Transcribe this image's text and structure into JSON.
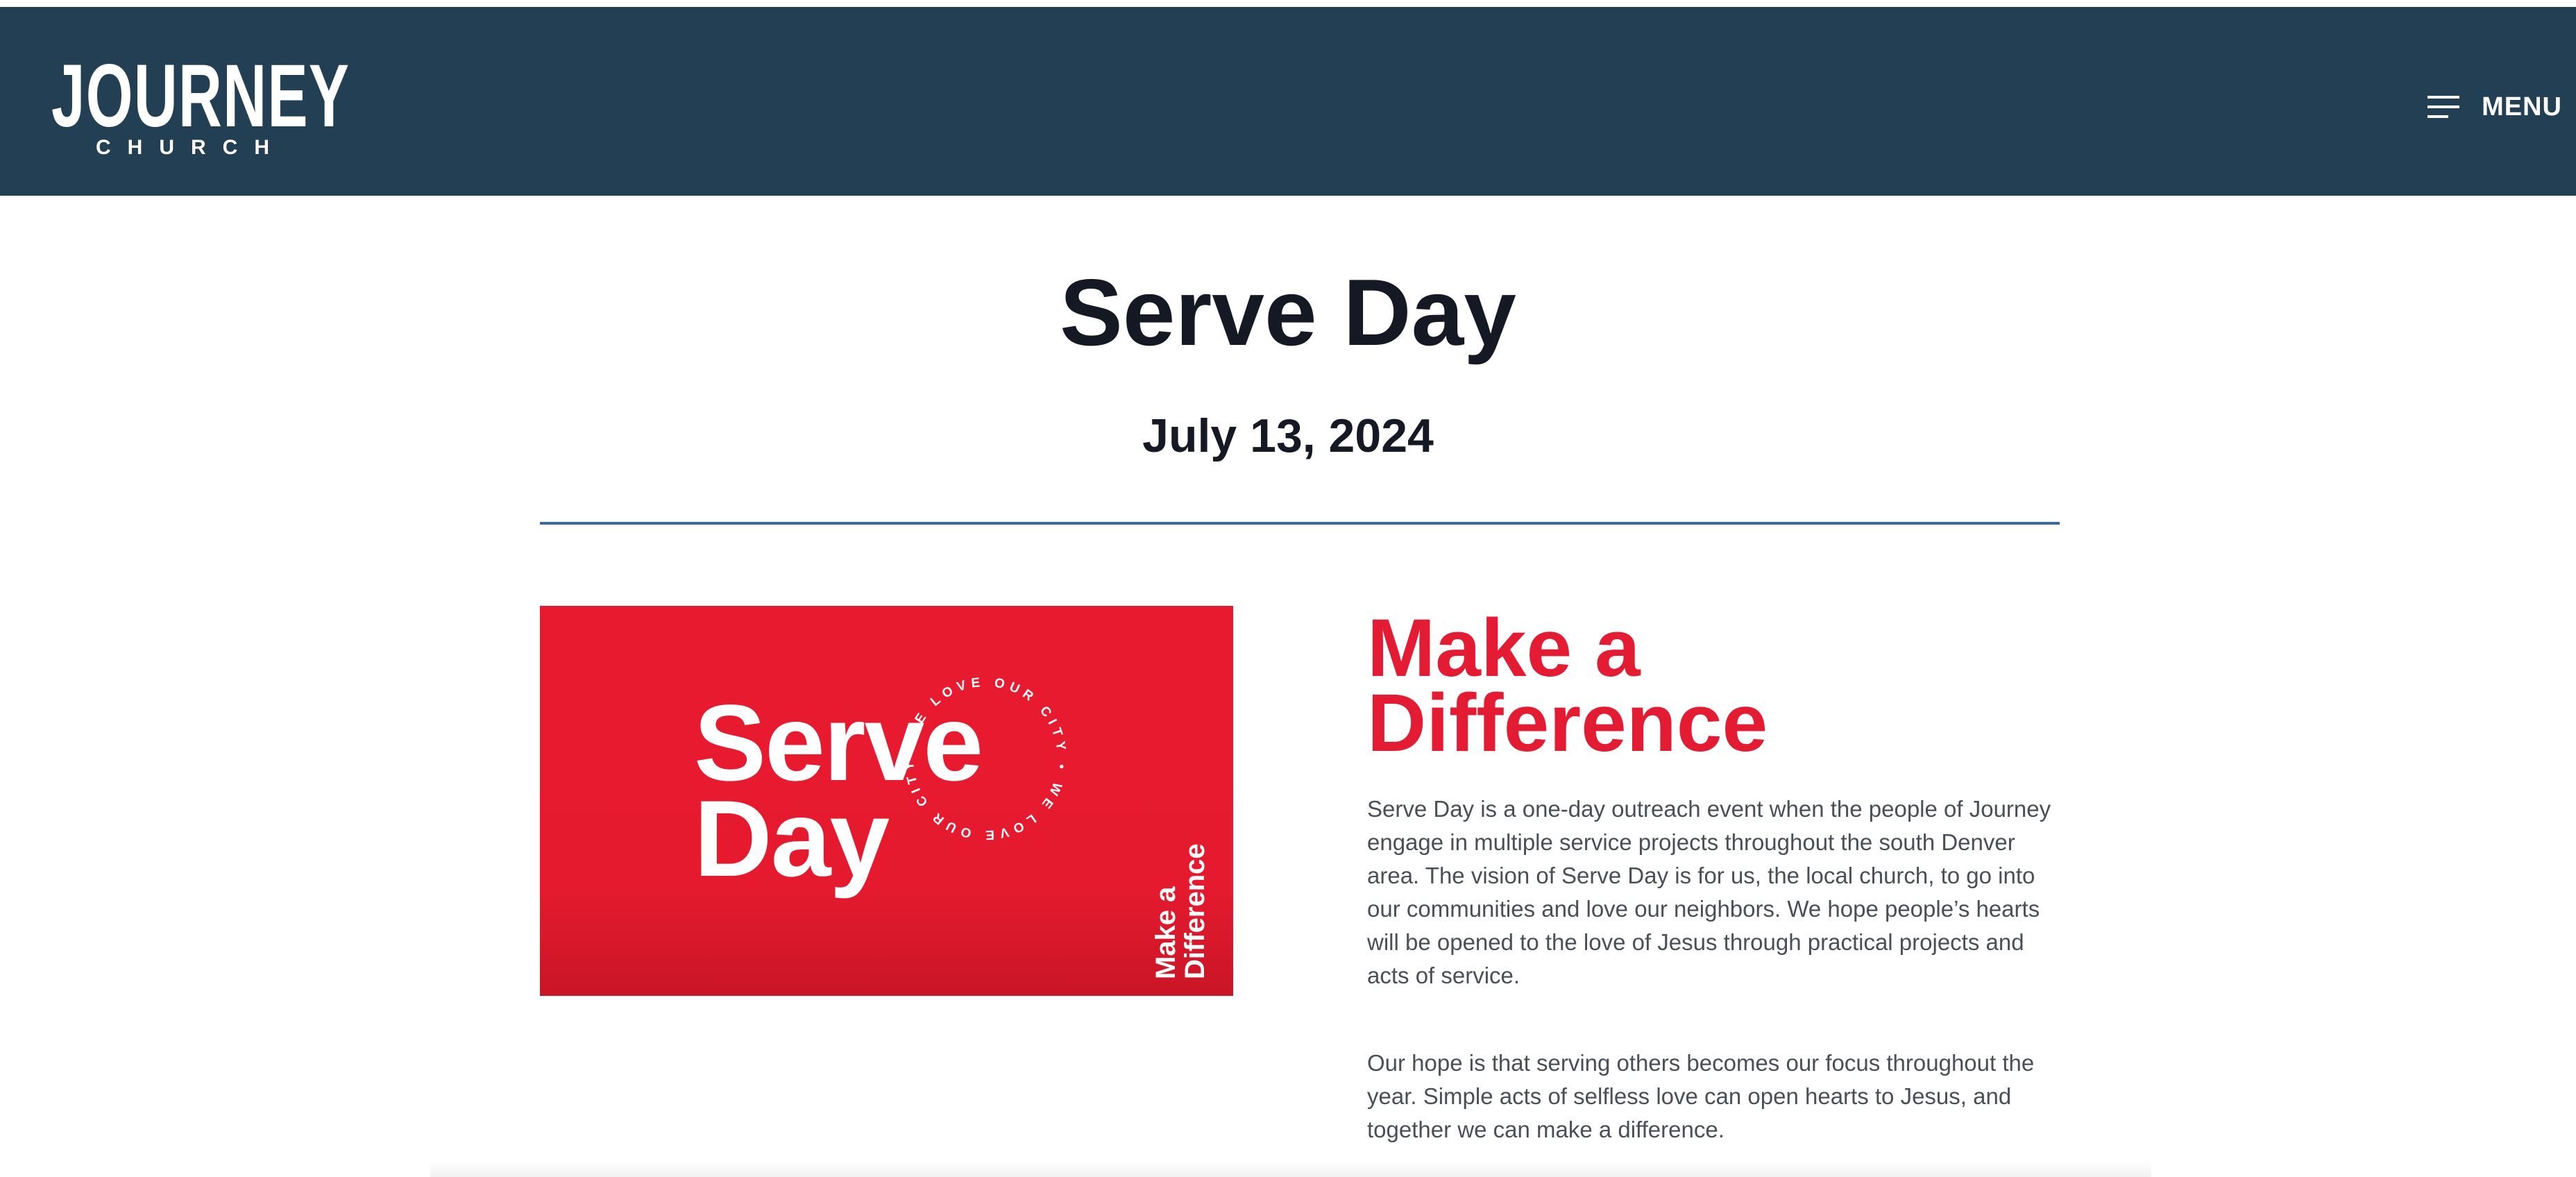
{
  "header": {
    "logo": {
      "wordmark": "JOURNEY",
      "subtitle": "CHURCH",
      "icon": "journey-j-icon"
    },
    "menu": {
      "label": "MENU",
      "icon": "hamburger-icon"
    }
  },
  "page": {
    "title": "Serve Day",
    "date": "July 13, 2024"
  },
  "hero_image": {
    "title_line1": "Serve",
    "title_line2": "Day",
    "ring_text": "WE LOVE OUR CITY • WE LOVE OUR CITY •",
    "side_line1": "Make a",
    "side_line2": "Difference"
  },
  "content": {
    "heading_line1": "Make a",
    "heading_line2": "Difference",
    "paragraph1": "Serve Day is a one-day outreach event when the people of Journey engage in multiple service projects throughout the south Denver area. The vision of Serve Day is for us, the local church, to go into our communities and love our neighbors. We hope people’s hearts will be opened to the love of Jesus through practical projects and acts of service.",
    "paragraph2": "Our hope is that serving others becomes our focus throughout the year. Simple acts of selfless love can open hearts to Jesus, and together we can make a difference."
  },
  "colors": {
    "header_bg": "#233f54",
    "accent_red": "#e31b33",
    "divider": "#3b6a9e",
    "title_text": "#151923",
    "body_text": "#4a4f57"
  }
}
